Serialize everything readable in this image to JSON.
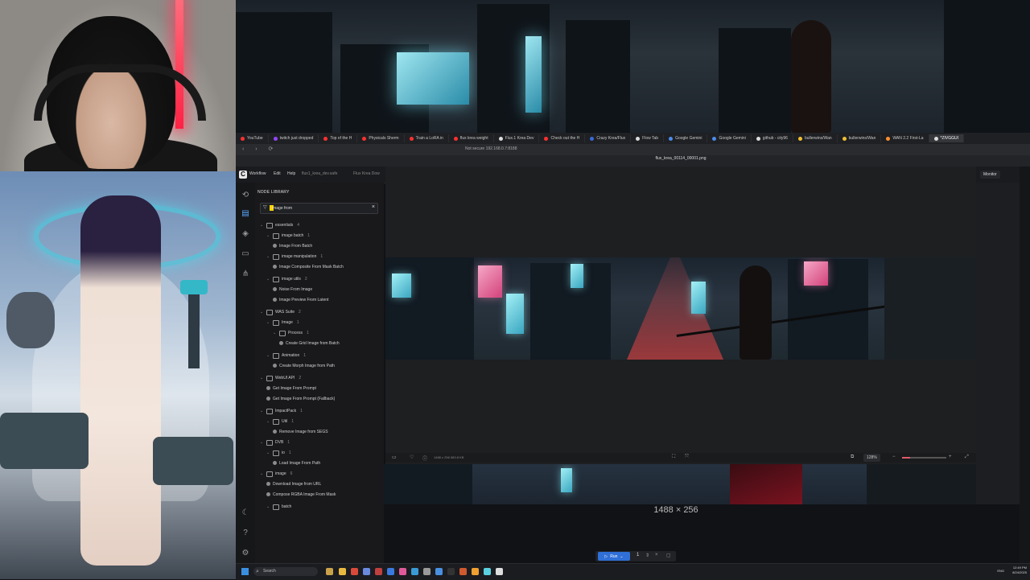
{
  "browser": {
    "tabs": [
      {
        "label": "YouTube",
        "color": "#ff3030"
      },
      {
        "label": "twitch just dropped",
        "color": "#9146ff"
      },
      {
        "label": "Top of the H",
        "color": "#ff3030"
      },
      {
        "label": "Physicals Sherm",
        "color": "#ff3030"
      },
      {
        "label": "Train a LoRA in",
        "color": "#ff3030"
      },
      {
        "label": "flux krea weight",
        "color": "#ff3030"
      },
      {
        "label": "Flux.1 Krea Dev",
        "color": "#dddddd"
      },
      {
        "label": "Check out the H",
        "color": "#ff3030"
      },
      {
        "label": "Crazy Krea/Flux",
        "color": "#3a6ad6"
      },
      {
        "label": "Flow Tab",
        "color": "#dddddd"
      },
      {
        "label": "Google Gemini",
        "color": "#4a8cf0"
      },
      {
        "label": "Google Gemini",
        "color": "#4a8cf0"
      },
      {
        "label": "github - city96",
        "color": "#dddddd"
      },
      {
        "label": "bullerwins/Wan",
        "color": "#f0c030"
      },
      {
        "label": "bullerwins/Wan",
        "color": "#f0c030"
      },
      {
        "label": "WAN 2.2 First-La",
        "color": "#ff9030"
      },
      {
        "label": "*ZIVGGUI",
        "color": "#dddddd",
        "active": true
      }
    ],
    "url": "Not secure   192.168.0.7:8188"
  },
  "menubar": {
    "items": [
      "Workflow",
      "Edit",
      "Help"
    ],
    "tabs": [
      "flux1_krea_dev.safe",
      "Flux Krea Dow"
    ],
    "monitor": "Monitor"
  },
  "library": {
    "title": "NODE LIBRARY",
    "search_value": "image from",
    "tree": [
      {
        "level": 0,
        "kind": "folder",
        "label": "essentials",
        "count": "4"
      },
      {
        "level": 1,
        "kind": "folder",
        "label": "image batch",
        "count": "1"
      },
      {
        "level": 2,
        "kind": "node",
        "label": "Image From Batch"
      },
      {
        "level": 1,
        "kind": "folder",
        "label": "image manipulation",
        "count": "1"
      },
      {
        "level": 2,
        "kind": "node",
        "label": "Image Composite From Mask Batch"
      },
      {
        "level": 1,
        "kind": "folder",
        "label": "image utils",
        "count": "2"
      },
      {
        "level": 2,
        "kind": "node",
        "label": "Noise From Image"
      },
      {
        "level": 2,
        "kind": "node",
        "label": "Image Preview From Latent"
      },
      {
        "level": 0,
        "kind": "folder",
        "label": "WAS Suite",
        "count": "2"
      },
      {
        "level": 1,
        "kind": "folder",
        "label": "Image",
        "count": "1"
      },
      {
        "level": 2,
        "kind": "folder",
        "label": "Process",
        "count": "1"
      },
      {
        "level": 3,
        "kind": "node",
        "label": "Create Grid Image from Batch"
      },
      {
        "level": 1,
        "kind": "folder",
        "label": "Animation",
        "count": "1"
      },
      {
        "level": 2,
        "kind": "node",
        "label": "Create Morph Image from Path"
      },
      {
        "level": 0,
        "kind": "folder",
        "label": "WebUI API",
        "count": "2"
      },
      {
        "level": 1,
        "kind": "node",
        "label": "Get Image From Prompt"
      },
      {
        "level": 1,
        "kind": "node",
        "label": "Get Image From Prompt (Fallback)"
      },
      {
        "level": 0,
        "kind": "folder",
        "label": "ImpactPack",
        "count": "1"
      },
      {
        "level": 1,
        "kind": "folder",
        "label": "Util",
        "count": "1"
      },
      {
        "level": 2,
        "kind": "node",
        "label": "Remove Image from SEGS"
      },
      {
        "level": 0,
        "kind": "folder",
        "label": "DVB",
        "count": "1"
      },
      {
        "level": 1,
        "kind": "folder",
        "label": "io",
        "count": "1"
      },
      {
        "level": 2,
        "kind": "node",
        "label": "Load Image From Path"
      },
      {
        "level": 0,
        "kind": "folder",
        "label": "image",
        "count": "6"
      },
      {
        "level": 1,
        "kind": "node",
        "label": "Download Image from URL"
      },
      {
        "level": 1,
        "kind": "node",
        "label": "Compose RGBA Image From Mask"
      },
      {
        "level": 1,
        "kind": "folder",
        "label": "batch",
        "count": ""
      }
    ]
  },
  "viewer": {
    "filename": "flux_krea_00114_00001.png",
    "meta": "1488 x 256     583.8 KB",
    "zoom": "128%"
  },
  "canvas": {
    "dimensions": "1488 × 256"
  },
  "runbar": {
    "run_label": "Run",
    "quantity": "1"
  },
  "taskbar": {
    "search_placeholder": "Search",
    "lang": "ENG",
    "time": "12:49 PM",
    "date": "8/24/2025"
  }
}
